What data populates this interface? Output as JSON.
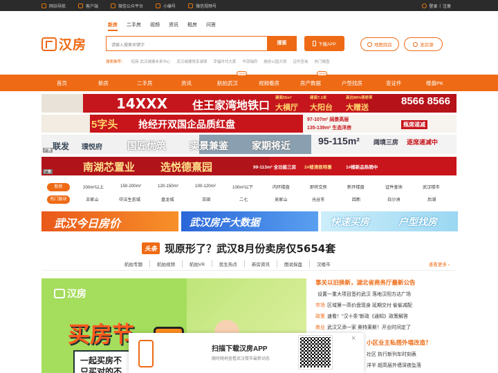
{
  "topbar": {
    "left": [
      "网站导航",
      "客户端",
      "微信公众平台",
      "小编号",
      "微信视频号"
    ],
    "login": "登录",
    "sep": "|",
    "register": "注册"
  },
  "logo": {
    "text": "汉房"
  },
  "search_tabs": [
    "新房",
    "二手房",
    "视频",
    "资讯",
    "租房",
    "问答"
  ],
  "search": {
    "placeholder": "请输入搜索关键字",
    "button": "搜索"
  },
  "app_button": "下载APP",
  "map_button": "地图找房",
  "publish_button": "发房源",
  "hot": {
    "label": "搜索推荐：",
    "items": [
      "招商·武汉城建未来中心",
      "武汉城建悦享湖璟",
      "幸福时代大家",
      "华润瑞府",
      "融创公园大观",
      "证件查询",
      "热门楼盘"
    ]
  },
  "nav": [
    "首页",
    "新房",
    "二手房",
    "资讯",
    "航拍武汉",
    "视频看房",
    "房产数据",
    "户型找房",
    "查证件",
    "楼盘PK"
  ],
  "nav_new": "NEW",
  "ads": {
    "a1": {
      "big": "14XXX",
      "main": "住王家湾地铁口",
      "r1": "建面55m²",
      "r2": "大横厅",
      "r3": "建面7.1米",
      "r4": "大阳台",
      "r5": "高达88%得房率",
      "r6": "大赠送",
      "tel": "8566 8566"
    },
    "a2": {
      "main": "5字头",
      "main2": "抢经开双国企品质红盘",
      "r1": "97-107m² 阔景高层",
      "r2": "135-139m² 生态洋房",
      "r3": "瓶席递减"
    },
    "a3": {
      "brand": "联发",
      "name": "璞悦府",
      "s1": "国匠优筑",
      "s2": "实景兼鉴",
      "s3": "家期将近",
      "area": "95-115m²",
      "d": "阔境三房",
      "r": "逐席递减中",
      "tag": "广告"
    },
    "a4": {
      "main": "南湖芯置业",
      "main2": "选悦德熹园",
      "r1": "99-113m² 全功能三房",
      "r2": "2#楼清栋特惠",
      "r3": "1#楼新品热销中",
      "tag": "广告"
    }
  },
  "filter_rows": [
    {
      "label": "新房",
      "items": [
        "200m²以上",
        "150-200m²",
        "120-150m²",
        "100-120m²",
        "100m²以下",
        "内环楼盘",
        "即将交房",
        "新开楼盘",
        "证件查询",
        "武汉楼市"
      ]
    },
    {
      "label": "热门板块",
      "items": [
        "王家山",
        "中法生态城",
        "盘龙城",
        "古田",
        "二七",
        "吴家山",
        "光谷东",
        "四新",
        "白沙洲",
        "后湖"
      ]
    }
  ],
  "promos": [
    "武汉今日房价",
    "武汉房产大数据",
    "快速买房",
    "户型找房"
  ],
  "headline": {
    "tag": "头条",
    "text": "现原形了？武汉8月份卖房仅5654套"
  },
  "sublinks": [
    "航拍专题",
    "航拍视频",
    "航拍VR",
    "民生热点",
    "新房资讯",
    "图说探盘",
    "汉楼市"
  ],
  "more": "查看更多 ›",
  "bigimg": {
    "logo": "汉房",
    "t1": "买房节",
    "t2": "一起买房不",
    "t3": "只买对的不"
  },
  "news_head": "事关以旧换新，湖北省商务厅最新公告",
  "news": [
    {
      "cat": "",
      "text": "设置一重大项目签约武汉 落地汉阳方达广场"
    },
    {
      "cat": "市场",
      "text": "区域第一高价盘现身 延期交付 偷偷减配"
    },
    {
      "cat": "政策",
      "text": "速看！\"汉十条\"新政《通知》政策解答"
    },
    {
      "cat": "商业",
      "text": "武汉又添一家 奥特莱斯！开业时间定了"
    }
  ],
  "news2": {
    "head": "小区业主私搭外墙改造？",
    "l1": "社区 执行新列车时刻表",
    "l2": "洋半 超高层外墙深夜坠落"
  },
  "popup": {
    "title": "扫描下载汉房APP",
    "sub": "随时随地查看武汉楼市最新动态",
    "close": "×"
  },
  "colors": {
    "brand": "#ee6a14",
    "dark": "#2b2b2b",
    "red_ad": "#c4161c"
  }
}
